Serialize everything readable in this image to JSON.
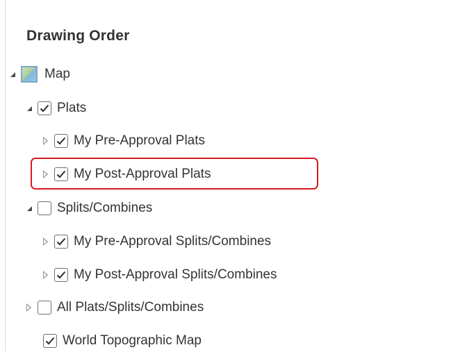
{
  "panel": {
    "title": "Drawing Order"
  },
  "tree": {
    "map": {
      "label": "Map",
      "icon": "map-icon",
      "expanded": true
    },
    "plats": {
      "label": "Plats",
      "checked": true,
      "expanded": true
    },
    "pre_approval_plats": {
      "label": "My Pre-Approval Plats",
      "checked": true,
      "expanded": false
    },
    "post_approval_plats": {
      "label": "My Post-Approval Plats",
      "checked": true,
      "expanded": false,
      "highlighted": true
    },
    "splits_combines": {
      "label": "Splits/Combines",
      "checked": false,
      "expanded": true
    },
    "pre_approval_splits": {
      "label": "My Pre-Approval Splits/Combines",
      "checked": true,
      "expanded": false
    },
    "post_approval_splits": {
      "label": "My Post-Approval Splits/Combines",
      "checked": true,
      "expanded": false
    },
    "all_plats_splits": {
      "label": "All Plats/Splits/Combines",
      "checked": false,
      "expanded": false
    },
    "world_topo": {
      "label": "World Topographic Map",
      "checked": true
    }
  },
  "colors": {
    "highlight": "#d7191f",
    "checkbox_border": "#6e6e6e",
    "text": "#333333"
  }
}
